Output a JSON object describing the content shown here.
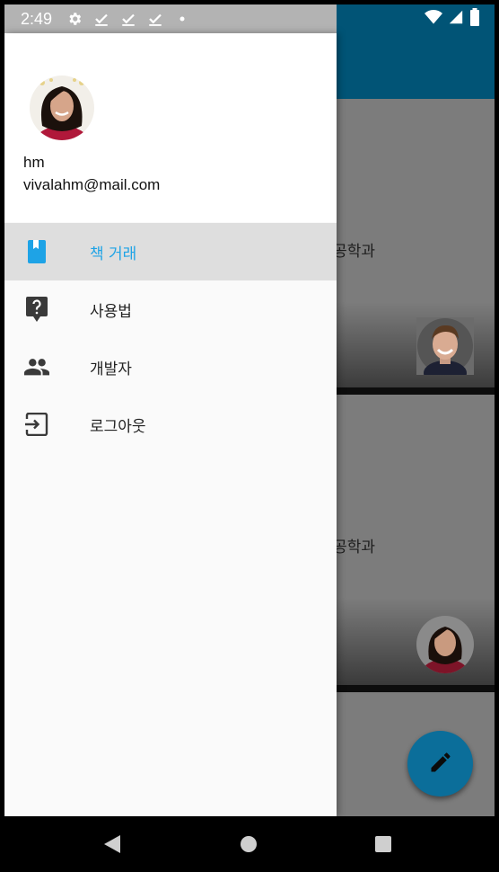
{
  "status_bar": {
    "time": "2:49",
    "left_icons": [
      "gear-icon",
      "check-download-icon",
      "check-download-icon",
      "check-download-icon",
      "dot-icon"
    ],
    "right_icons": [
      "wifi-icon",
      "signal-icon",
      "battery-icon"
    ]
  },
  "drawer": {
    "user": {
      "name": "hm",
      "email": "vivalahm@mail.com"
    },
    "menu": [
      {
        "label": "책 거래",
        "icon": "book-icon",
        "active": true
      },
      {
        "label": "사용법",
        "icon": "help-icon",
        "active": false
      },
      {
        "label": "개발자",
        "icon": "people-icon",
        "active": false
      },
      {
        "label": "로그아웃",
        "icon": "logout-icon",
        "active": false
      }
    ]
  },
  "background": {
    "cards": [
      {
        "text": "-공학과"
      },
      {
        "text": "-공학과"
      }
    ],
    "fab_icon": "edit-icon"
  },
  "nav_bar": {
    "buttons": [
      "back-icon",
      "home-icon",
      "recents-icon"
    ]
  },
  "colors": {
    "toolbar": "#015476",
    "accent": "#1ea3e6",
    "fab": "#0b6e9a"
  }
}
